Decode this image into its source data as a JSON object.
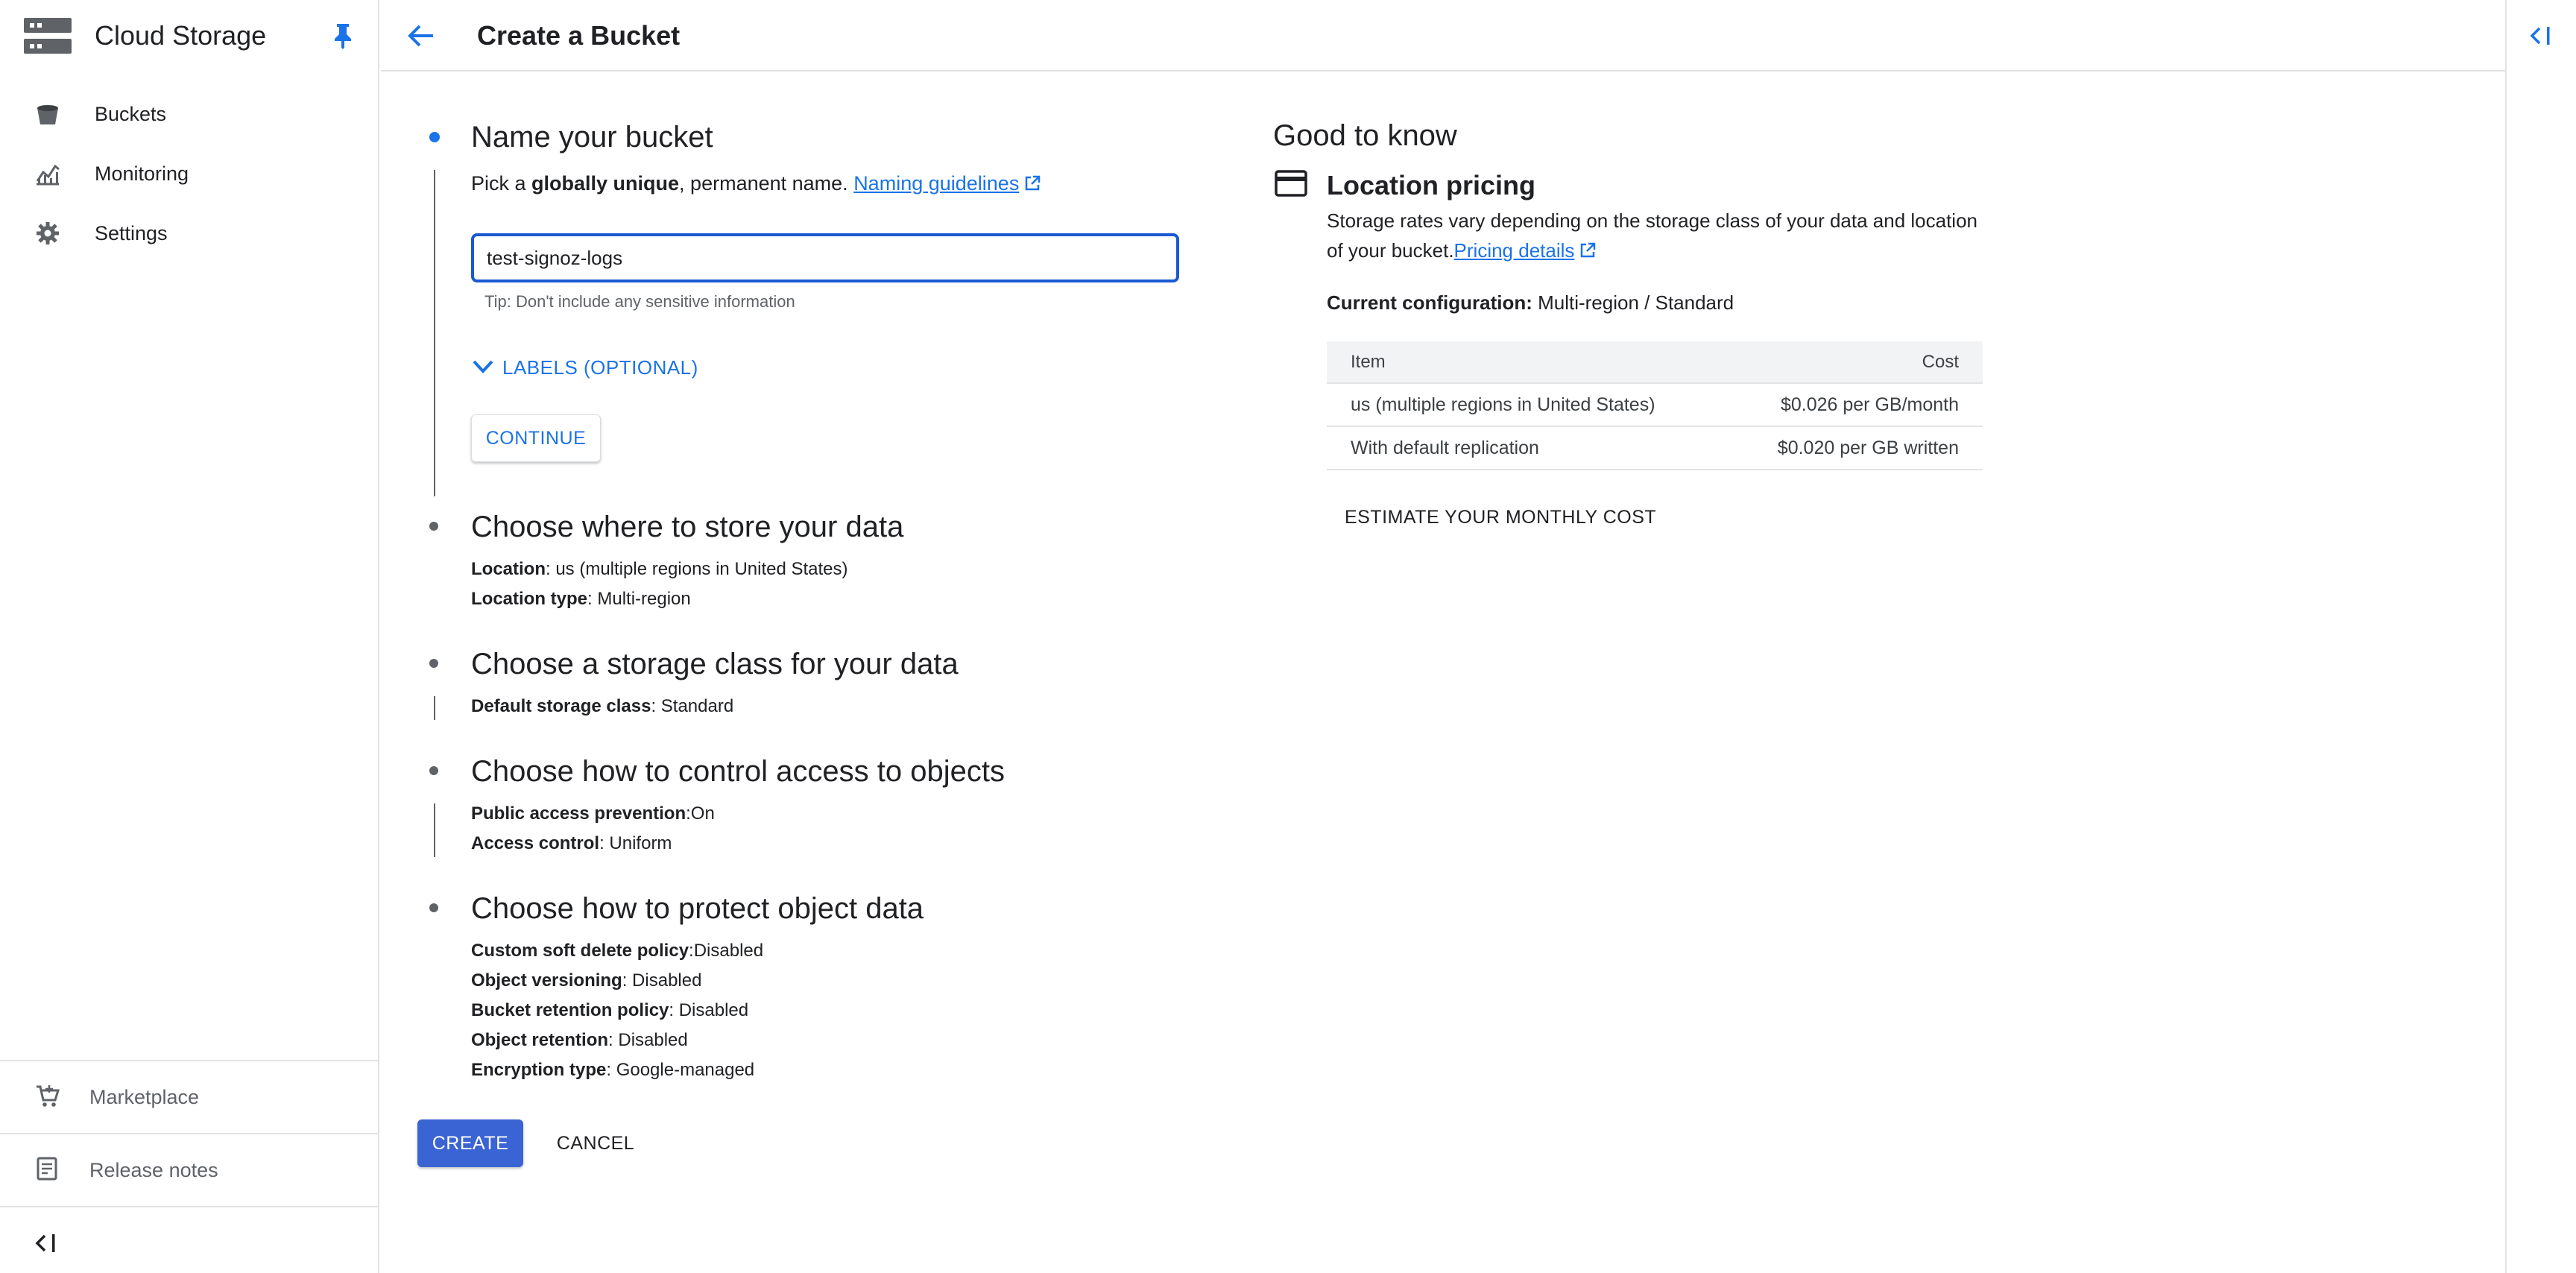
{
  "sidebar": {
    "product_title": "Cloud Storage",
    "product_icon": "storage-icon",
    "nav": [
      {
        "label": "Buckets",
        "icon": "bucket-icon"
      },
      {
        "label": "Monitoring",
        "icon": "monitoring-icon"
      },
      {
        "label": "Settings",
        "icon": "gear-icon"
      }
    ],
    "bottom": [
      {
        "label": "Marketplace",
        "icon": "cart-icon"
      },
      {
        "label": "Release notes",
        "icon": "release-notes-icon"
      }
    ]
  },
  "header": {
    "title": "Create a Bucket"
  },
  "form": {
    "steps": [
      {
        "title": "Name your bucket"
      },
      {
        "title": "Choose where to store your data"
      },
      {
        "title": "Choose a storage class for your data"
      },
      {
        "title": "Choose how to control access to objects"
      },
      {
        "title": "Choose how to protect object data"
      }
    ],
    "name_step": {
      "hint_prefix": "Pick a ",
      "hint_bold": "globally unique",
      "hint_suffix": ", permanent name. ",
      "naming_link": "Naming guidelines",
      "input_value": "test-signoz-logs",
      "tip": "Tip: Don't include any sensitive information",
      "labels_toggle": "LABELS (OPTIONAL)",
      "continue_label": "CONTINUE"
    },
    "location_step": [
      {
        "label": "Location",
        "value": ": us (multiple regions in United States)"
      },
      {
        "label": "Location type",
        "value": ": Multi-region"
      }
    ],
    "storage_class_step": [
      {
        "label": "Default storage class",
        "value": ": Standard"
      }
    ],
    "access_step": [
      {
        "label": "Public access prevention",
        "value": ":On"
      },
      {
        "label": "Access control",
        "value": ": Uniform"
      }
    ],
    "protection_step": [
      {
        "label": "Custom soft delete policy",
        "value": ":Disabled"
      },
      {
        "label": "Object versioning",
        "value": ": Disabled"
      },
      {
        "label": "Bucket retention policy",
        "value": ": Disabled"
      },
      {
        "label": "Object retention",
        "value": ": Disabled"
      },
      {
        "label": "Encryption type",
        "value": ": Google-managed"
      }
    ],
    "create_label": "CREATE",
    "cancel_label": "CANCEL"
  },
  "good_to_know": {
    "title": "Good to know",
    "location_pricing": {
      "title": "Location pricing",
      "description": "Storage rates vary depending on the storage class of your data and location of your bucket.",
      "pricing_link": "Pricing details",
      "current_label": "Current configuration:",
      "current_value": " Multi-region / Standard",
      "table": {
        "headers": [
          "Item",
          "Cost"
        ],
        "rows": [
          [
            "us (multiple regions in United States)",
            "$0.026 per GB/month"
          ],
          [
            "With default replication",
            "$0.020 per GB written"
          ]
        ]
      },
      "estimate_label": "ESTIMATE YOUR MONTHLY COST"
    }
  },
  "colors": {
    "accent": "#1a73e8",
    "primary_button": "#3a63d3",
    "input_focus": "#1a58d4"
  }
}
